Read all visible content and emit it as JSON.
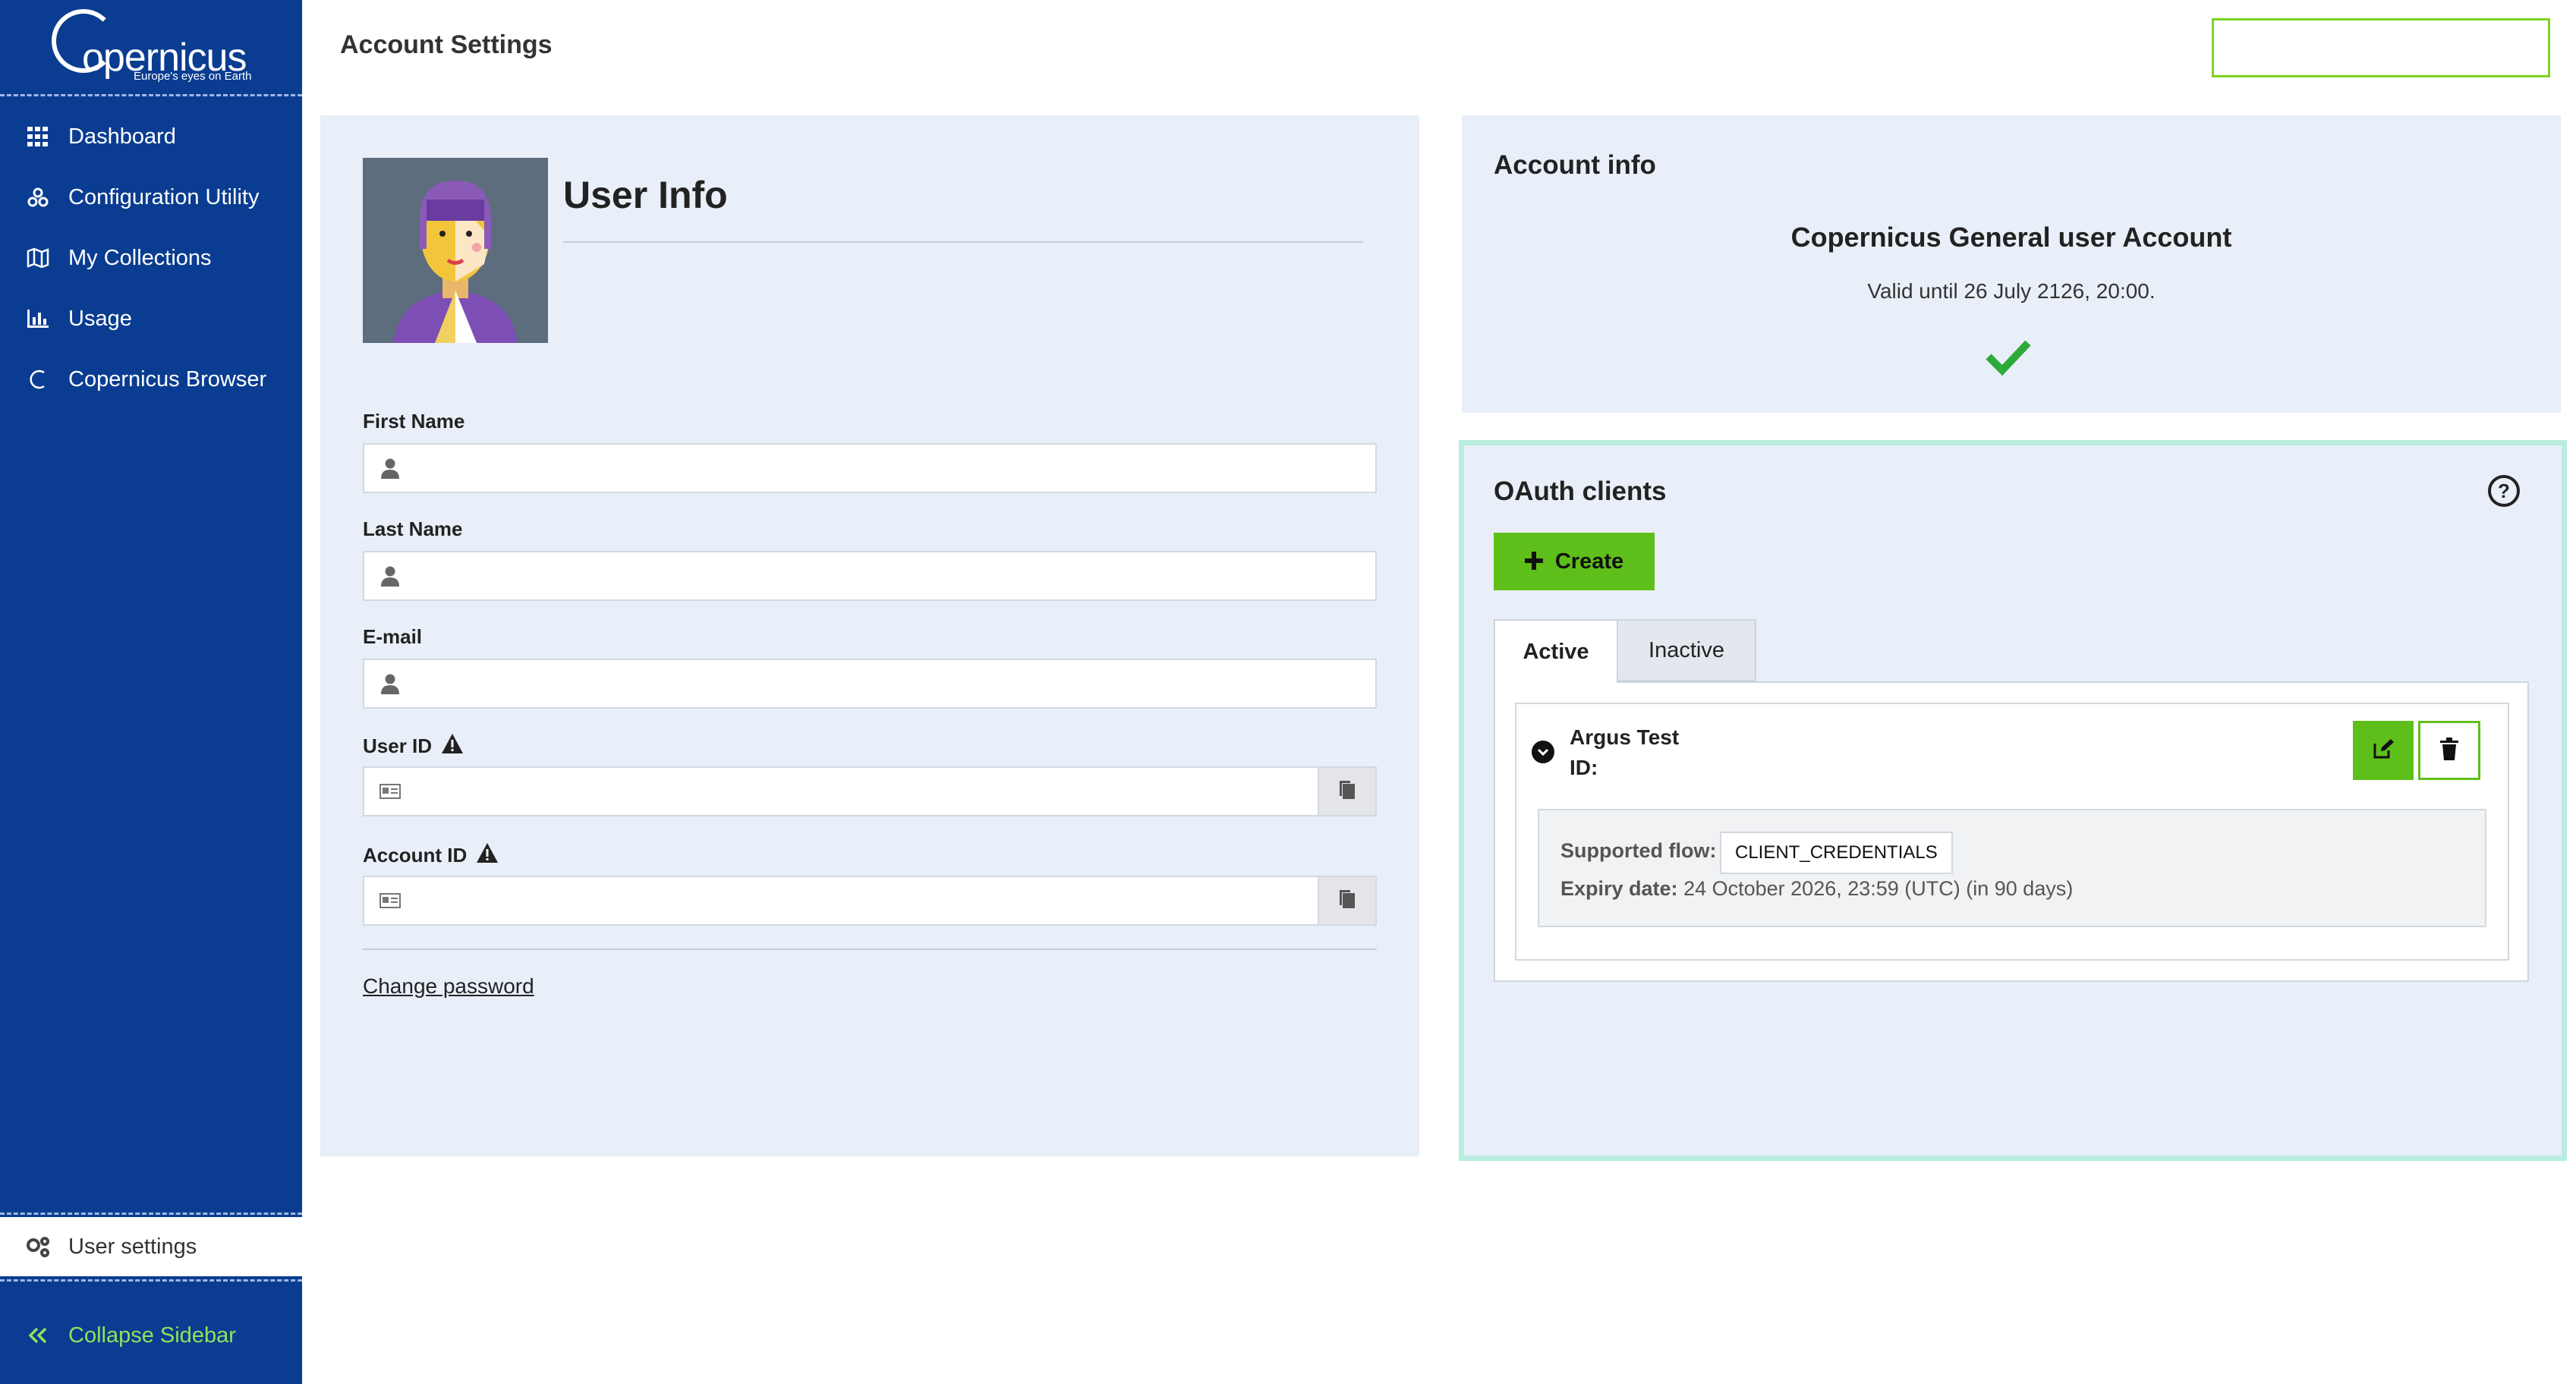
{
  "sidebar": {
    "logo_word": "opernicus",
    "logo_tagline": "Europe's eyes on Earth",
    "items": [
      {
        "label": "Dashboard",
        "icon": "grid-icon"
      },
      {
        "label": "Configuration Utility",
        "icon": "cogs-icon"
      },
      {
        "label": "My Collections",
        "icon": "map-icon"
      },
      {
        "label": "Usage",
        "icon": "bar-chart-icon"
      },
      {
        "label": "Copernicus Browser",
        "icon": "copernicus-c-icon"
      }
    ],
    "user_settings": "User settings",
    "collapse": "Collapse Sidebar"
  },
  "header": {
    "title": "Account Settings"
  },
  "user_info": {
    "title": "User Info",
    "first_name": {
      "label": "First Name",
      "value": ""
    },
    "last_name": {
      "label": "Last Name",
      "value": ""
    },
    "email": {
      "label": "E-mail",
      "value": ""
    },
    "user_id": {
      "label": "User ID",
      "value": ""
    },
    "account_id": {
      "label": "Account ID",
      "value": ""
    },
    "change_password": "Change password"
  },
  "account_info": {
    "title": "Account info",
    "account_name": "Copernicus General user Account",
    "valid_until": "Valid until 26 July 2126, 20:00."
  },
  "oauth": {
    "title": "OAuth clients",
    "help": "?",
    "create_label": "Create",
    "tabs": [
      {
        "label": "Active",
        "selected": true
      },
      {
        "label": "Inactive",
        "selected": false
      }
    ],
    "clients": [
      {
        "name": "Argus Test",
        "id_label": "ID:",
        "supported_flow_label": "Supported flow:",
        "supported_flow": "CLIENT_CREDENTIALS",
        "expiry_label": "Expiry date:",
        "expiry_value": "24 October 2026, 23:59 (UTC) (in 90 days)"
      }
    ]
  },
  "colors": {
    "sidebar_bg": "#0a3d91",
    "panel_bg": "#e9eff8",
    "accent_green": "#5fbf1a",
    "collapse_text": "#8ce35c",
    "oauth_border": "#b8ecdf",
    "check_green": "#2eaa3a"
  }
}
